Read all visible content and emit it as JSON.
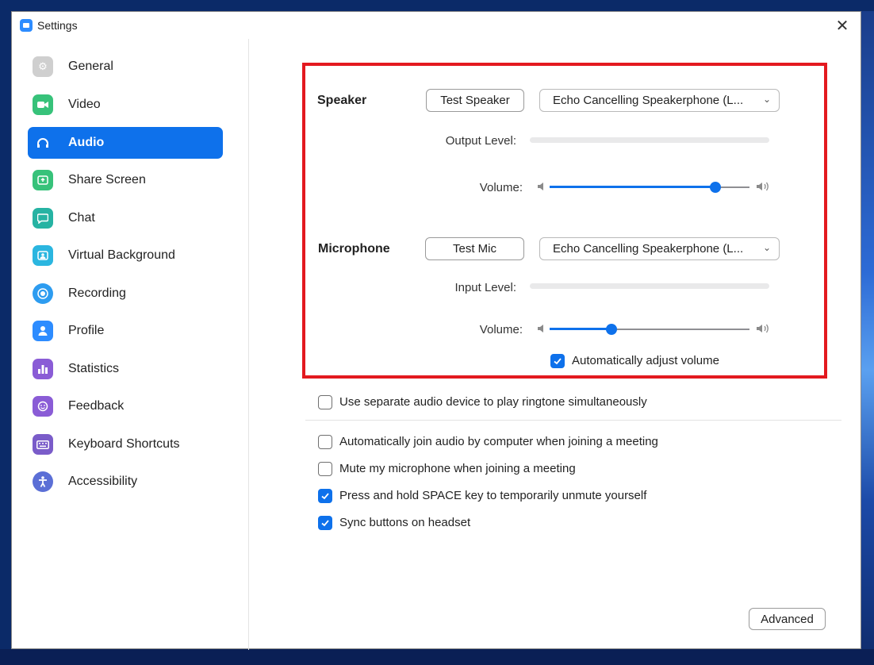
{
  "window": {
    "title": "Settings",
    "close_glyph": "✕"
  },
  "sidebar": {
    "items": [
      {
        "label": "General",
        "icon": "gear-icon",
        "color": "#cfcfcf"
      },
      {
        "label": "Video",
        "icon": "video-camera-icon",
        "color": "#37c27a"
      },
      {
        "label": "Audio",
        "icon": "headphones-icon",
        "color": "#0e71eb",
        "active": true
      },
      {
        "label": "Share Screen",
        "icon": "share-screen-icon",
        "color": "#37c27a"
      },
      {
        "label": "Chat",
        "icon": "chat-bubble-icon",
        "color": "#26b3a3"
      },
      {
        "label": "Virtual Background",
        "icon": "virtual-background-icon",
        "color": "#2bb6e0"
      },
      {
        "label": "Recording",
        "icon": "record-icon",
        "color": "#2d9cf0"
      },
      {
        "label": "Profile",
        "icon": "profile-icon",
        "color": "#2d8cff"
      },
      {
        "label": "Statistics",
        "icon": "statistics-icon",
        "color": "#8a5cd6"
      },
      {
        "label": "Feedback",
        "icon": "feedback-icon",
        "color": "#8a5cd6"
      },
      {
        "label": "Keyboard Shortcuts",
        "icon": "keyboard-icon",
        "color": "#7a5cc9"
      },
      {
        "label": "Accessibility",
        "icon": "accessibility-icon",
        "color": "#5b6fd6"
      }
    ]
  },
  "speaker": {
    "section_label": "Speaker",
    "test_button": "Test Speaker",
    "device": "Echo Cancelling Speakerphone (L...",
    "output_level_label": "Output Level:",
    "volume_label": "Volume:",
    "volume_level": 0.83
  },
  "microphone": {
    "section_label": "Microphone",
    "test_button": "Test Mic",
    "device": "Echo Cancelling Speakerphone (L...",
    "input_level_label": "Input Level:",
    "volume_label": "Volume:",
    "volume_level": 0.31,
    "auto_adjust_label": "Automatically adjust volume",
    "auto_adjust_checked": true
  },
  "options": [
    {
      "label": "Use separate audio device to play ringtone simultaneously",
      "checked": false
    },
    {
      "label": "Automatically join audio by computer when joining a meeting",
      "checked": false
    },
    {
      "label": "Mute my microphone when joining a meeting",
      "checked": false
    },
    {
      "label": "Press and hold SPACE key to temporarily unmute yourself",
      "checked": true
    },
    {
      "label": "Sync buttons on headset",
      "checked": true
    }
  ],
  "advanced_button": "Advanced",
  "colors": {
    "accent": "#0e71eb",
    "highlight_box": "#e3191f"
  }
}
